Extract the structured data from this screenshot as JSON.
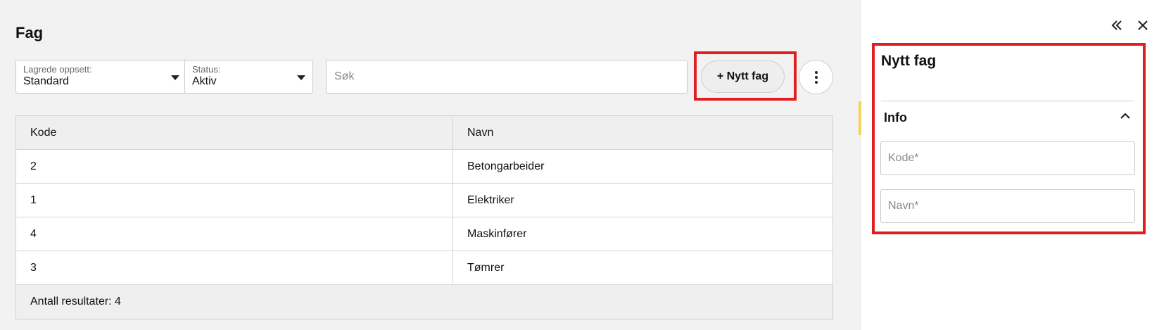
{
  "page": {
    "title": "Fag"
  },
  "filters": {
    "saved_layout": {
      "label": "Lagrede oppsett:",
      "value": "Standard"
    },
    "status": {
      "label": "Status:",
      "value": "Aktiv"
    },
    "search": {
      "placeholder": "Søk",
      "value": ""
    }
  },
  "toolbar": {
    "new_button_label": "+ Nytt fag",
    "more_icon": "more-vertical-icon"
  },
  "table": {
    "columns": [
      "Kode",
      "Navn"
    ],
    "rows": [
      {
        "kode": "2",
        "navn": "Betongarbeider"
      },
      {
        "kode": "1",
        "navn": "Elektriker"
      },
      {
        "kode": "4",
        "navn": "Maskinfører"
      },
      {
        "kode": "3",
        "navn": "Tømrer"
      }
    ],
    "footer": "Antall resultater: 4"
  },
  "panel": {
    "title": "Nytt fag",
    "section_title": "Info",
    "fields": {
      "kode": {
        "placeholder": "Kode*",
        "value": ""
      },
      "navn": {
        "placeholder": "Navn*",
        "value": ""
      }
    },
    "icons": {
      "collapse": "double-chevron-left-icon",
      "close": "close-icon",
      "section_toggle": "chevron-up-icon"
    }
  },
  "colors": {
    "highlight": "#e02020",
    "accent": "#f4d35e"
  }
}
